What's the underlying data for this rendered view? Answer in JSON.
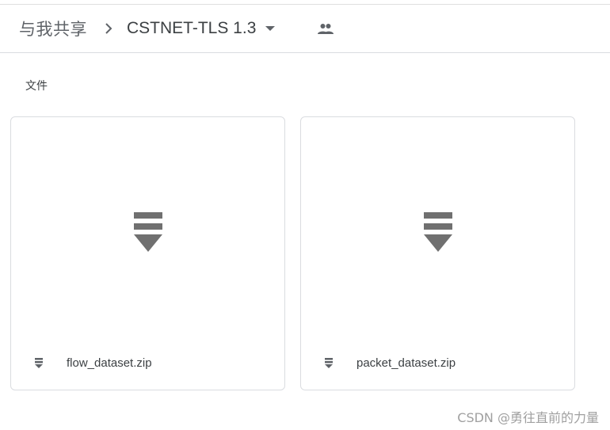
{
  "breadcrumb": {
    "root_label": "与我共享",
    "current_folder": "CSTNET-TLS 1.3"
  },
  "icons": {
    "separator": "chevron-right-icon",
    "dropdown": "caret-down-icon",
    "shared": "people-icon",
    "file_type": "zip-file-icon"
  },
  "section": {
    "label": "文件"
  },
  "files": [
    {
      "name": "flow_dataset.zip"
    },
    {
      "name": "packet_dataset.zip"
    }
  ],
  "watermark": "CSDN @勇往直前的力量",
  "colors": {
    "icon_gray": "#5f6368",
    "text": "#3c4043",
    "border": "#dadce0"
  }
}
